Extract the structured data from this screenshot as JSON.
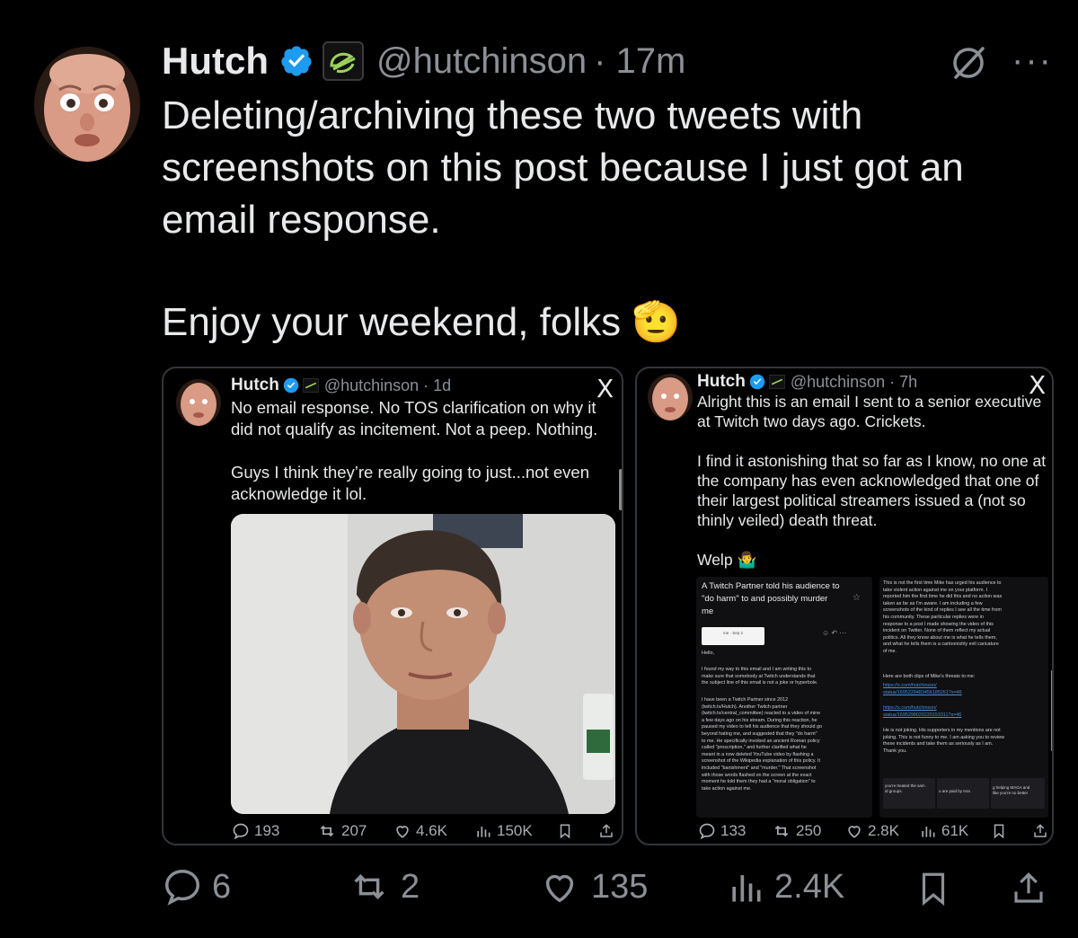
{
  "tweet": {
    "name": "Hutch",
    "handle": "@hutchinson",
    "time": "· 17m",
    "text_line1": "Deleting/archiving these two tweets with\nscreenshots on this post because I just got an\nemail response.",
    "text_line2": "Enjoy your weekend, folks",
    "emoji": "🫡",
    "icons": [
      "verified-badge-icon",
      "optic-affiliate-icon",
      "grok-icon",
      "more-icon"
    ],
    "stats": {
      "replies": "6",
      "reposts": "2",
      "likes": "135",
      "views": "2.4K"
    }
  },
  "embed1": {
    "name": "Hutch",
    "handle": "@hutchinson · 1d",
    "text": "No email response. No TOS clarification on why it\ndid not qualify as incitement. Not a peep. Nothing.\n\nGuys I think they’re really going to just...not even\nacknowledge it lol.",
    "x_logo": "X",
    "stats": {
      "replies": "193",
      "reposts": "207",
      "likes": "4.6K",
      "views": "150K"
    }
  },
  "embed2": {
    "name": "Hutch",
    "handle": "@hutchinson · 7h",
    "text": "Alright this is an email I sent to a senior executive\nat Twitch two days ago. Crickets.\n\nI find it astonishing that so far as I know, no one at\nthe company has even acknowledged that one of\ntheir largest political streamers issued a (not so\nthinly veiled) death threat.\n\nWelp",
    "emoji": "🤷‍♂️",
    "x_logo": "X",
    "stats": {
      "replies": "133",
      "reposts": "250",
      "likes": "2.8K",
      "views": "61K"
    },
    "email_left": {
      "subject": "A Twitch Partner told his audience to\n\"do harm\" to and possibly murder\nme",
      "meta": "me · Sep 2",
      "greeting": "Hello,",
      "para1": "I found my way to this email and I am writing this to\nmake sure that somebody at Twitch understands that\nthe subject line of this email is not a joke or hyperbole.",
      "para2": "I have been a Twitch Partner since 2012\n(twitch.tv/Hutch). Another Twitch partner\n(twitch.tv/central_committee) reacted to a video of mine\na few days ago on his stream. During this reaction, he\npaused my video to tell his audience that they should go\nbeyond hating me, and suggested that they \"do harm\"\nto me. He specifically invoked an ancient Roman policy\ncalled \"proscription,\" and further clarified what he\nmeant in a now deleted YouTube video by flashing a\nscreenshot of the Wikipedia explanation of this policy. It\nincluded \"banishment\" and \"murder.\" That screenshot\nwith those words flashed on the screen at the exact\nmoment he told them they had a \"moral obligation\" to\ntake action against me."
    },
    "email_right": {
      "para1": "This is not the first time Mike has urged his audience to\ntake violent action against me on your platform. I\nreported him the first time he did this and no action was\ntaken as far as I'm aware. I am including a few\nscreenshots of the kind of replies I see all the time from\nhis community. These particular replies were in\nresponse to a post I made showing the video of this\nincident on Twitter. None of them reflect my actual\npolitics. All they know about me is what he tells them,\nand what he tells them is a cartoonishly evil caricature\nof me.",
      "para2": "Here are both clips of Mike's threats to me:",
      "link1": "https://x.com/hutchinson/\nstatus/1695229483456185261?s=46",
      "link2": "https://x.com/hutchinson/\nstatus/1695298020220153311?s=46",
      "para3": "He is not joking. His supporters in my mentions are not\njoking. This is not funny to me. I am asking you to review\nthese incidents and take them as seriously as I am.\nThank you.",
      "thumb1": "you're treated the sam\nid groups.",
      "thumb2": "u are paid by Isra",
      "thumb3": "g helping MAGA and\nlike you're no better"
    }
  },
  "colors": {
    "background": "#000000",
    "text": "#e7e9ea",
    "muted": "#8b9096",
    "verified": "#1d9bf0",
    "border": "#333639"
  }
}
